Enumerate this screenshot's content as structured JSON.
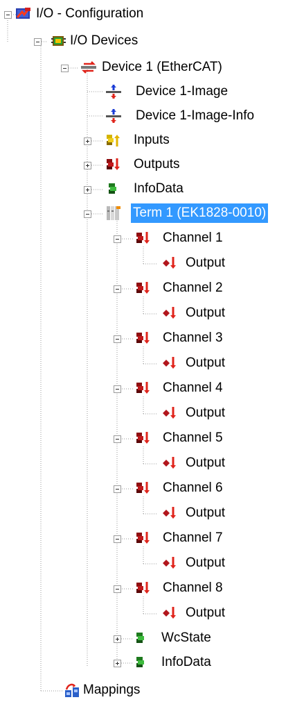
{
  "tree": {
    "root": {
      "label": "I/O - Configuration",
      "icon": "io-configuration-icon"
    },
    "io_devices": {
      "label": "I/O Devices",
      "icon": "io-devices-icon"
    },
    "device1": {
      "label": "Device 1 (EtherCAT)",
      "icon": "ethercat-device-icon"
    },
    "device1_image": {
      "label": "Device 1-Image",
      "icon": "process-image-icon"
    },
    "device1_image_info": {
      "label": "Device 1-Image-Info",
      "icon": "process-image-icon"
    },
    "inputs": {
      "label": "Inputs",
      "icon": "inputs-icon"
    },
    "outputs": {
      "label": "Outputs",
      "icon": "outputs-icon"
    },
    "infodata": {
      "label": "InfoData",
      "icon": "infodata-icon"
    },
    "term1": {
      "label": "Term 1 (EK1828-0010)",
      "icon": "terminal-icon",
      "selected": true
    },
    "channels": [
      {
        "label": "Channel 1",
        "output": "Output"
      },
      {
        "label": "Channel 2",
        "output": "Output"
      },
      {
        "label": "Channel 3",
        "output": "Output"
      },
      {
        "label": "Channel 4",
        "output": "Output"
      },
      {
        "label": "Channel 5",
        "output": "Output"
      },
      {
        "label": "Channel 6",
        "output": "Output"
      },
      {
        "label": "Channel 7",
        "output": "Output"
      },
      {
        "label": "Channel 8",
        "output": "Output"
      }
    ],
    "wcstate": {
      "label": "WcState",
      "icon": "wcstate-icon"
    },
    "term_infodata": {
      "label": "InfoData",
      "icon": "infodata-icon"
    },
    "mappings": {
      "label": "Mappings",
      "icon": "mappings-icon"
    }
  },
  "colors": {
    "selection": "#3399ff",
    "guide": "#9a9a9a",
    "output_arrow": "#e0241b",
    "input_arrow": "#e2b400",
    "green_var": "#2e9b2e",
    "red_var": "#b2161c"
  }
}
